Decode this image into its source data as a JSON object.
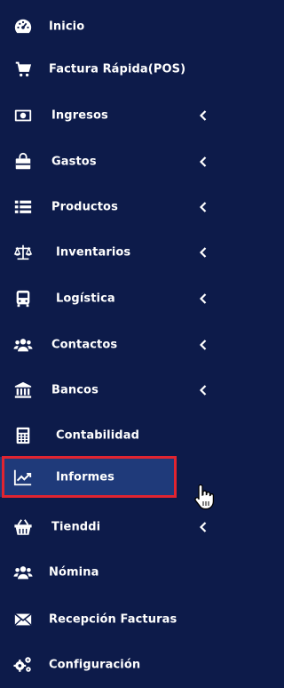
{
  "menu": {
    "items": [
      {
        "label": "Inicio",
        "icon": "dashboard-icon",
        "has_submenu": false
      },
      {
        "label": "Factura Rápida(POS)",
        "icon": "cart-icon",
        "has_submenu": false
      },
      {
        "label": "Ingresos",
        "icon": "money-icon",
        "has_submenu": true
      },
      {
        "label": "Gastos",
        "icon": "shopping-bag-icon",
        "has_submenu": true
      },
      {
        "label": "Productos",
        "icon": "list-icon",
        "has_submenu": true
      },
      {
        "label": "Inventarios",
        "icon": "balance-scale-icon",
        "has_submenu": true
      },
      {
        "label": "Logística",
        "icon": "bus-icon",
        "has_submenu": true
      },
      {
        "label": "Contactos",
        "icon": "users-icon",
        "has_submenu": true
      },
      {
        "label": "Bancos",
        "icon": "bank-icon",
        "has_submenu": true
      },
      {
        "label": "Contabilidad",
        "icon": "calculator-icon",
        "has_submenu": false
      },
      {
        "label": "Informes",
        "icon": "line-chart-icon",
        "has_submenu": false,
        "active": true
      },
      {
        "label": "Tienddi",
        "icon": "basket-icon",
        "has_submenu": true
      },
      {
        "label": "Nómina",
        "icon": "users-icon",
        "has_submenu": false
      },
      {
        "label": "Recepción Facturas",
        "icon": "envelope-icon",
        "has_submenu": false
      },
      {
        "label": "Configuración",
        "icon": "gears-icon",
        "has_submenu": false
      }
    ]
  },
  "colors": {
    "sidebar_bg": "#0d1b4a",
    "active_bg": "#1f3a7a",
    "highlight_border": "#e02430",
    "text": "#ffffff"
  }
}
